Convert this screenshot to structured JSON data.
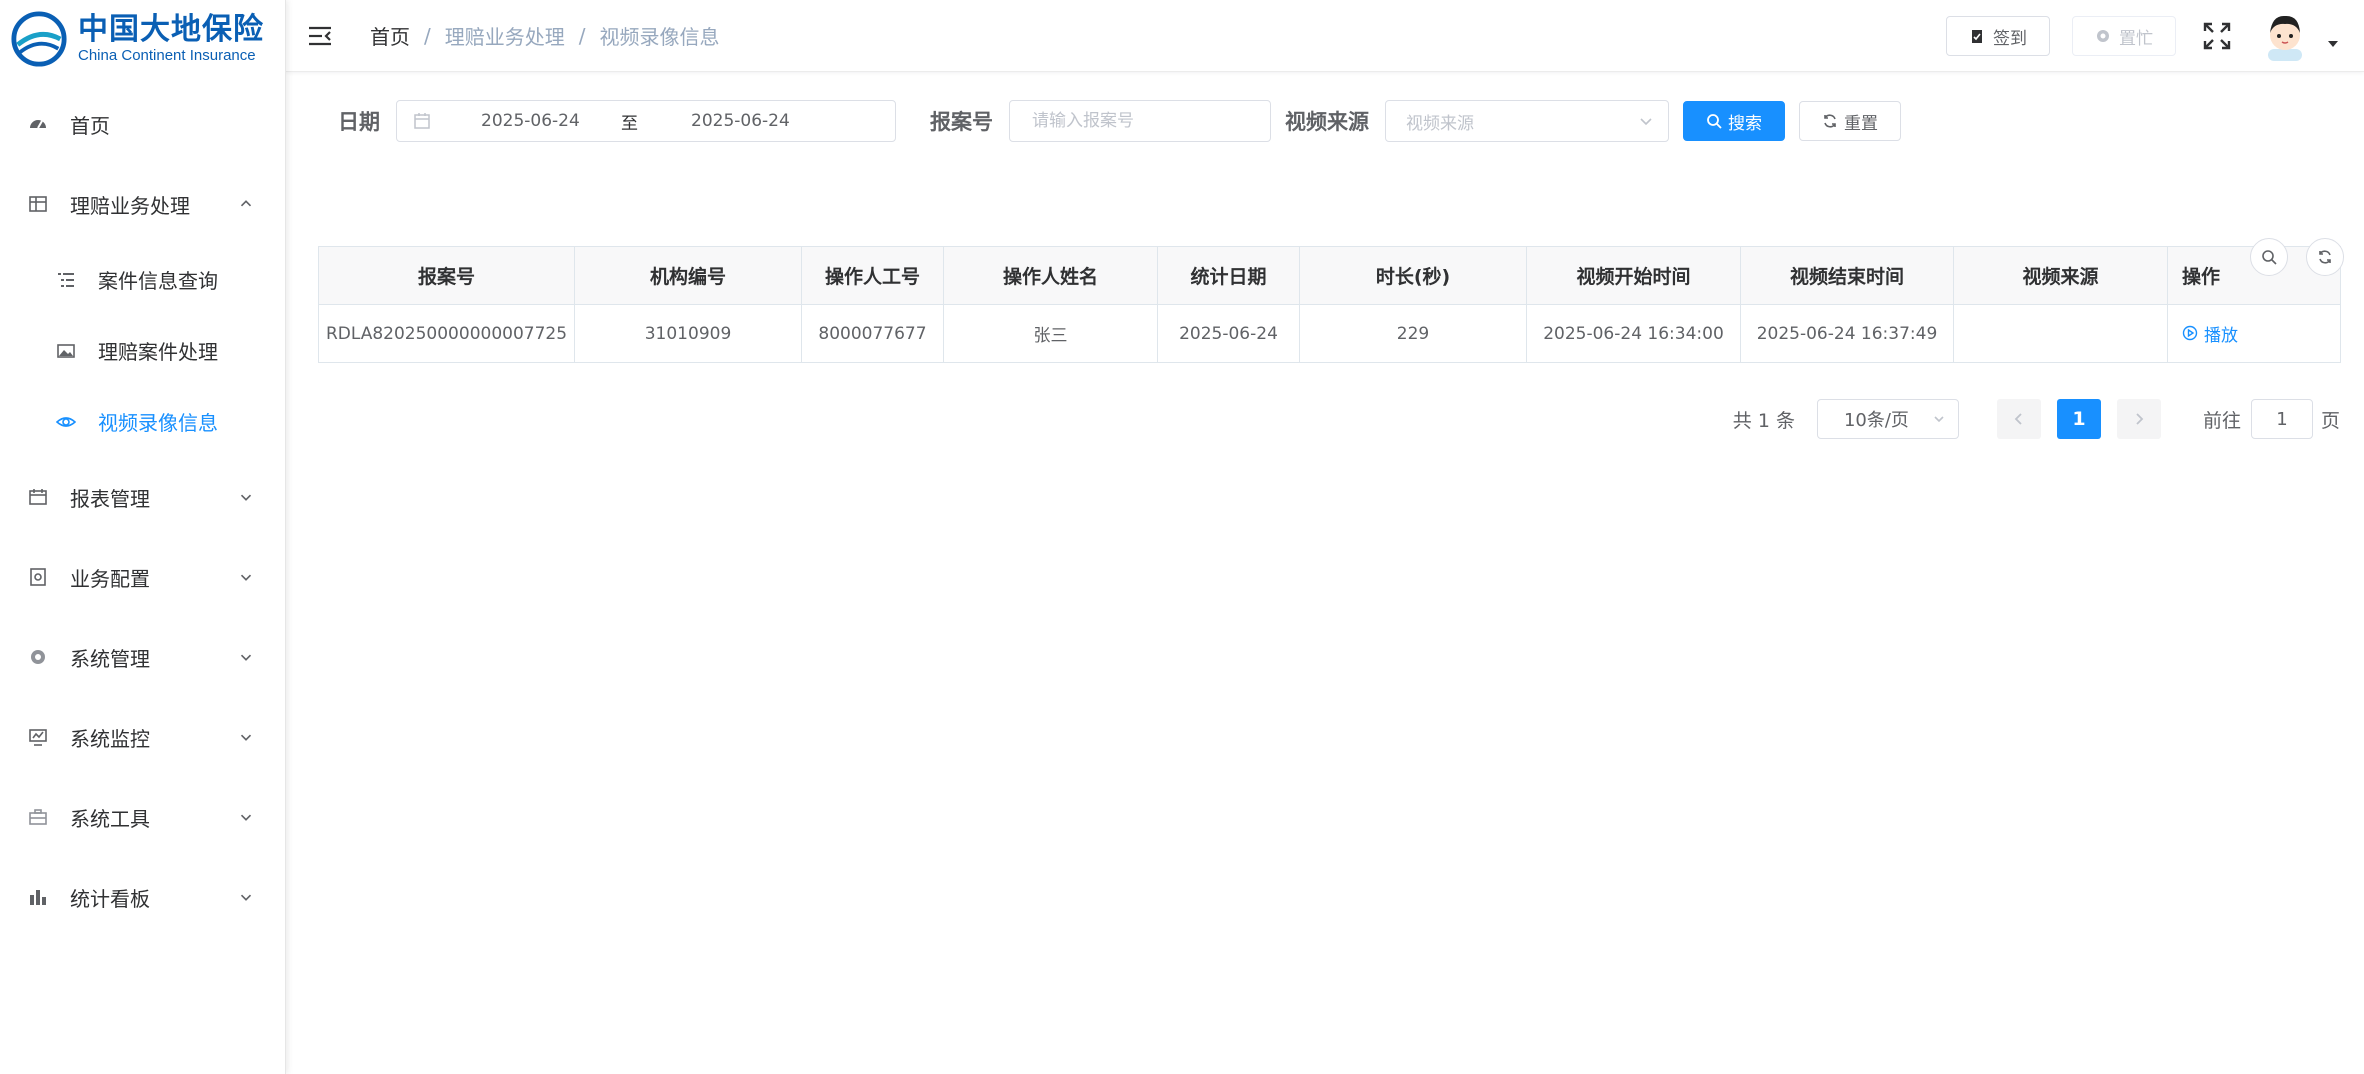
{
  "brand": {
    "name_cn": "中国大地保险",
    "name_en": "China Continent Insurance",
    "color": "#0a5fb4"
  },
  "accent_color": "#1890ff",
  "sidebar": {
    "items": [
      {
        "label": "首页",
        "icon": "dashboard-icon"
      },
      {
        "label": "理赔业务处理",
        "icon": "grid-icon",
        "expanded": true,
        "children": [
          {
            "label": "案件信息查询",
            "icon": "list-icon"
          },
          {
            "label": "理赔案件处理",
            "icon": "image-icon"
          },
          {
            "label": "视频录像信息",
            "icon": "eye-icon",
            "active": true
          }
        ]
      },
      {
        "label": "报表管理",
        "icon": "calendar-icon"
      },
      {
        "label": "业务配置",
        "icon": "safe-icon"
      },
      {
        "label": "系统管理",
        "icon": "gear-icon"
      },
      {
        "label": "系统监控",
        "icon": "monitor-icon"
      },
      {
        "label": "系统工具",
        "icon": "toolbox-icon"
      },
      {
        "label": "统计看板",
        "icon": "bar-chart-icon"
      }
    ]
  },
  "navbar": {
    "breadcrumb": [
      "首页",
      "理赔业务处理",
      "视频录像信息"
    ],
    "sign_in_label": "签到",
    "busy_label": "置忙"
  },
  "filters": {
    "date_label": "日期",
    "date_start": "2025-06-24",
    "date_to": "至",
    "date_end": "2025-06-24",
    "case_no_label": "报案号",
    "case_no_placeholder": "请输入报案号",
    "source_label": "视频来源",
    "source_placeholder": "视频来源",
    "search_label": "搜索",
    "reset_label": "重置"
  },
  "table": {
    "headers": [
      "报案号",
      "机构编号",
      "操作人工号",
      "操作人姓名",
      "统计日期",
      "时长(秒)",
      "视频开始时间",
      "视频结束时间",
      "视频来源",
      "操作"
    ],
    "rows": [
      {
        "case_no": "RDLA820250000000007725",
        "org_no": "31010909",
        "operator_id": "8000077677",
        "operator_name": "张三",
        "stat_date": "2025-06-24",
        "duration": "229",
        "start_time": "2025-06-24 16:34:00",
        "end_time": "2025-06-24 16:37:49",
        "source": "",
        "action": "播放"
      }
    ]
  },
  "pagination": {
    "total_text": "共 1 条",
    "page_size": "10条/页",
    "current_page": "1",
    "goto_label": "前往",
    "goto_value": "1",
    "page_suffix": "页"
  }
}
